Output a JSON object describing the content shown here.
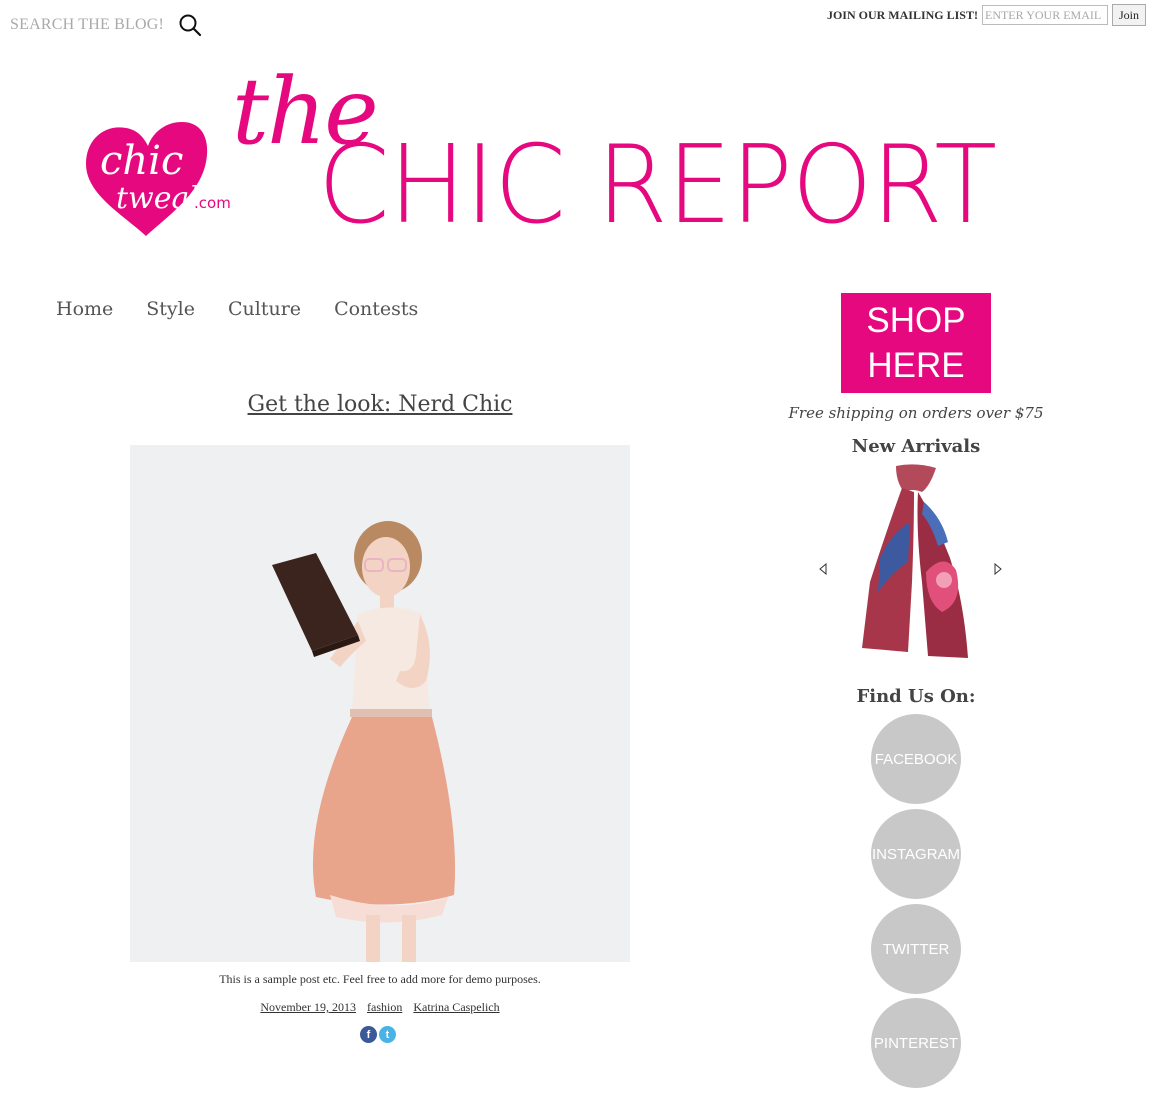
{
  "topbar": {
    "search_placeholder": "SEARCH THE BLOG!",
    "mailing_label": "JOIN OUR MAILING LIST!",
    "email_placeholder": "ENTER YOUR EMAIL",
    "join_label": "Join"
  },
  "header": {
    "logo_text": "chic tweak .com",
    "brand_the": "the",
    "brand_main": "CHIC REPORT",
    "accent": "#e6087f"
  },
  "nav": {
    "items": [
      {
        "label": "Home"
      },
      {
        "label": "Style"
      },
      {
        "label": "Culture"
      },
      {
        "label": "Contests"
      }
    ]
  },
  "post": {
    "title": "Get the look: Nerd Chic",
    "caption": "This is a sample post etc. Feel free to add more for demo purposes.",
    "date": "November 19, 2013",
    "category": "fashion",
    "author": "Katrina Caspelich",
    "share": [
      {
        "name": "facebook",
        "glyph": "f",
        "color": "#3b5998"
      },
      {
        "name": "twitter",
        "glyph": "t",
        "color": "#4ab3e6"
      }
    ]
  },
  "sidebar": {
    "shop_line1": "SHOP",
    "shop_line2": "HERE",
    "free_shipping": "Free shipping on orders over $75",
    "new_arrivals_heading": "New Arrivals",
    "find_us_heading": "Find Us On:",
    "social": [
      {
        "label": "FACEBOOK"
      },
      {
        "label": "INSTAGRAM"
      },
      {
        "label": "TWITTER"
      },
      {
        "label": "PINTEREST"
      }
    ]
  }
}
